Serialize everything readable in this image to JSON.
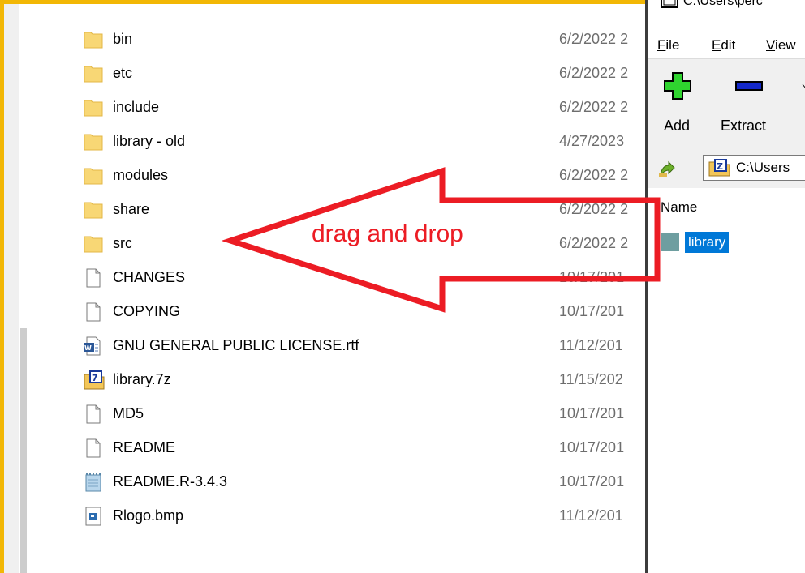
{
  "explorer": {
    "files": [
      {
        "name": "bin",
        "date": "6/2/2022 2",
        "icon": "folder-icon"
      },
      {
        "name": "etc",
        "date": "6/2/2022 2",
        "icon": "folder-icon"
      },
      {
        "name": "include",
        "date": "6/2/2022 2",
        "icon": "folder-icon"
      },
      {
        "name": "library - old",
        "date": "4/27/2023",
        "icon": "folder-icon"
      },
      {
        "name": "modules",
        "date": "6/2/2022 2",
        "icon": "folder-icon"
      },
      {
        "name": "share",
        "date": "6/2/2022 2",
        "icon": "folder-icon"
      },
      {
        "name": "src",
        "date": "6/2/2022 2",
        "icon": "folder-icon"
      },
      {
        "name": "CHANGES",
        "date": "10/17/201",
        "icon": "file-icon"
      },
      {
        "name": "COPYING",
        "date": "10/17/201",
        "icon": "file-icon"
      },
      {
        "name": "GNU GENERAL PUBLIC LICENSE.rtf",
        "date": "11/12/201",
        "icon": "wordpad-doc-icon"
      },
      {
        "name": "library.7z",
        "date": "11/15/202",
        "icon": "7z-archive-icon"
      },
      {
        "name": "MD5",
        "date": "10/17/201",
        "icon": "file-icon"
      },
      {
        "name": "README",
        "date": "10/17/201",
        "icon": "file-icon"
      },
      {
        "name": "README.R-3.4.3",
        "date": "10/17/201",
        "icon": "notepad-doc-icon"
      },
      {
        "name": "Rlogo.bmp",
        "date": "11/12/201",
        "icon": "bitmap-icon"
      }
    ]
  },
  "sevenzip": {
    "title": "C:\\Users\\perc",
    "menu": [
      {
        "label": "File",
        "underline": "F",
        "rest": "ile"
      },
      {
        "label": "Edit",
        "underline": "E",
        "rest": "dit"
      },
      {
        "label": "View",
        "underline": "V",
        "rest": "iew"
      }
    ],
    "toolbar": {
      "add_label": "Add",
      "extract_label": "Extract"
    },
    "address": "C:\\Users",
    "column_name": "Name",
    "selected_item": "library"
  },
  "annotation": {
    "text": "drag and drop",
    "color": "#ec1c24"
  },
  "colors": {
    "border": "#f2b705",
    "selection": "#0078d7"
  }
}
